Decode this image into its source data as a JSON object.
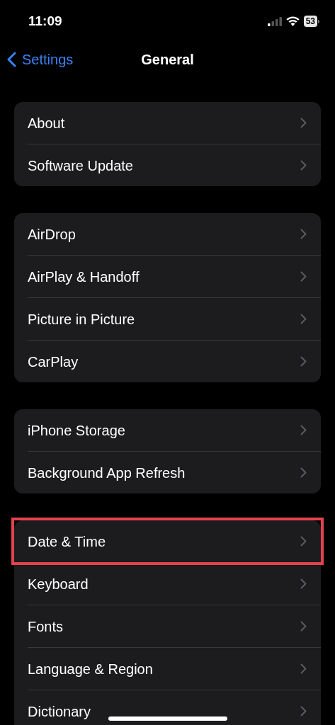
{
  "status_bar": {
    "time": "11:09",
    "battery": "53"
  },
  "nav": {
    "back": "Settings",
    "title": "General"
  },
  "groups": [
    {
      "items": [
        {
          "label": "About",
          "highlighted": false
        },
        {
          "label": "Software Update",
          "highlighted": false
        }
      ]
    },
    {
      "items": [
        {
          "label": "AirDrop",
          "highlighted": false
        },
        {
          "label": "AirPlay & Handoff",
          "highlighted": false
        },
        {
          "label": "Picture in Picture",
          "highlighted": false
        },
        {
          "label": "CarPlay",
          "highlighted": false
        }
      ]
    },
    {
      "items": [
        {
          "label": "iPhone Storage",
          "highlighted": false
        },
        {
          "label": "Background App Refresh",
          "highlighted": false
        }
      ]
    },
    {
      "items": [
        {
          "label": "Date & Time",
          "highlighted": true
        },
        {
          "label": "Keyboard",
          "highlighted": false
        },
        {
          "label": "Fonts",
          "highlighted": false
        },
        {
          "label": "Language & Region",
          "highlighted": false
        },
        {
          "label": "Dictionary",
          "highlighted": false
        }
      ]
    }
  ]
}
